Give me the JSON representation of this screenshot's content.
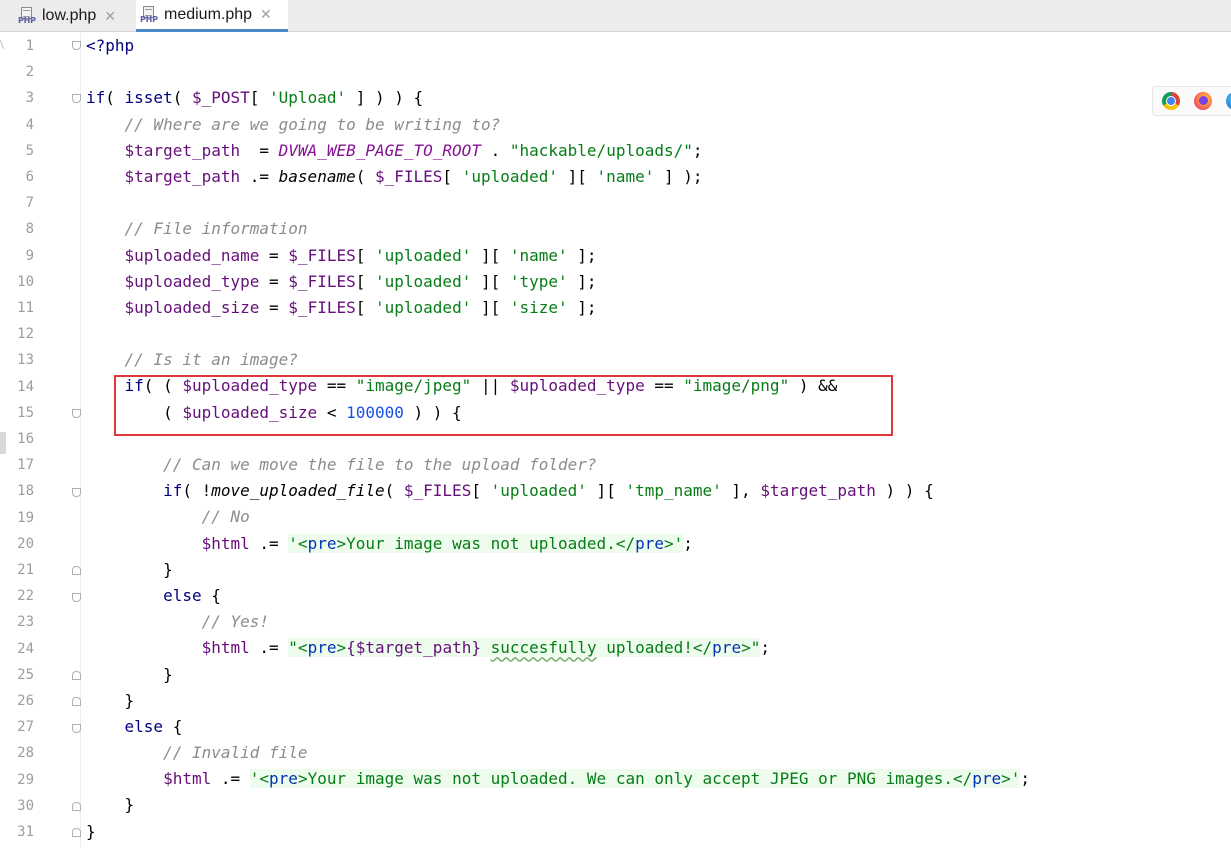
{
  "tabs": [
    {
      "label": "low.php",
      "badge": "PHP",
      "active": false
    },
    {
      "label": "medium.php",
      "badge": "PHP",
      "active": true
    }
  ],
  "tab_close_glyph": "✕",
  "edge_glyph": "\\",
  "line_numbers": [
    "1",
    "2",
    "3",
    "4",
    "5",
    "6",
    "7",
    "8",
    "9",
    "10",
    "11",
    "12",
    "13",
    "14",
    "15",
    "16",
    "17",
    "18",
    "19",
    "20",
    "21",
    "22",
    "23",
    "24",
    "25",
    "26",
    "27",
    "28",
    "29",
    "30",
    "31"
  ],
  "code": {
    "l1": "<?php",
    "l3_if": "if",
    "l3_a": "( ",
    "l3_isset": "isset",
    "l3_b": "( ",
    "l3_post": "$_POST",
    "l3_c": "[ ",
    "l3_str": "'Upload'",
    "l3_d": " ] ) ) {",
    "l4": "// Where are we going to be writing to?",
    "l5_var": "$target_path",
    "l5_op": "  = ",
    "l5_const": "DVWA_WEB_PAGE_TO_ROOT",
    "l5_dot": " . ",
    "l5_str": "\"hackable/uploads/\"",
    "l5_end": ";",
    "l6_var": "$target_path",
    "l6_op": " .= ",
    "l6_fn": "basename",
    "l6_a": "( ",
    "l6_files": "$_FILES",
    "l6_b": "[ ",
    "l6_s1": "'uploaded'",
    "l6_c": " ][ ",
    "l6_s2": "'name'",
    "l6_d": " ] );",
    "l8": "// File information",
    "l9_var": "$uploaded_name",
    "l9_s2": "'name'",
    "l10_var": "$uploaded_type",
    "l10_s2": "'type'",
    "l11_var": "$uploaded_size",
    "l11_s2": "'size'",
    "eq": " = ",
    "files": "$_FILES",
    "br_open": "[ ",
    "br_mid": " ][ ",
    "br_end": " ];",
    "s_uploaded": "'uploaded'",
    "l13": "// Is it an image?",
    "l14_if": "if",
    "l14_a": "( ( ",
    "l14_var1": "$uploaded_type",
    "l14_eq": " == ",
    "l14_s1": "\"image/jpeg\"",
    "l14_or": " || ",
    "l14_var2": "$uploaded_type",
    "l14_s2": "\"image/png\"",
    "l14_end": " ) &&",
    "l15_a": "( ",
    "l15_var": "$uploaded_size",
    "l15_lt": " < ",
    "l15_num": "100000",
    "l15_end": " ) ) {",
    "l17": "// Can we move the file to the upload folder?",
    "l18_if": "if",
    "l18_a": "( !",
    "l18_fn": "move_uploaded_file",
    "l18_b": "( ",
    "l18_files": "$_FILES",
    "l18_c": "[ ",
    "l18_s1": "'uploaded'",
    "l18_d": " ][ ",
    "l18_s2": "'tmp_name'",
    "l18_e": " ], ",
    "l18_var": "$target_path",
    "l18_f": " ) ) {",
    "l19": "// No",
    "l20_var": "$html",
    "l20_op": " .= ",
    "l20_q1": "'<",
    "l20_t1": "pre",
    "l20_m1": ">Your image was not uploaded.</",
    "l20_t2": "pre",
    "l20_q2": ">'",
    "l20_end": ";",
    "brace_close": "}",
    "else_kw": "else",
    "else_brace": " {",
    "l23": "// Yes!",
    "l24_var": "$html",
    "l24_op": " .= ",
    "l24_q1": "\"<",
    "l24_t1": "pre",
    "l24_m1": ">",
    "l24_interp": "{$target_path}",
    "l24_sp": " ",
    "l24_sq": "succesfully",
    "l24_m2": " uploaded!</",
    "l24_t2": "pre",
    "l24_q2": ">\"",
    "l24_end": ";",
    "l28": "// Invalid file",
    "l29_var": "$html",
    "l29_op": " .= ",
    "l29_q1": "'<",
    "l29_t1": "pre",
    "l29_m1": ">Your image was not uploaded. We can only accept JPEG or PNG images.</",
    "l29_t2": "pre",
    "l29_q2": ">'",
    "l29_end": ";",
    "l31": "}"
  },
  "browser_icons": [
    "chrome-icon",
    "firefox-icon",
    "edge-icon"
  ],
  "colors": {
    "keyword": "#000080",
    "variable": "#660e7a",
    "string": "#067d17",
    "comment": "#8c8c8c",
    "number": "#1750eb",
    "highlight_box": "#e0373b",
    "active_tab_underline": "#4a88c7"
  }
}
